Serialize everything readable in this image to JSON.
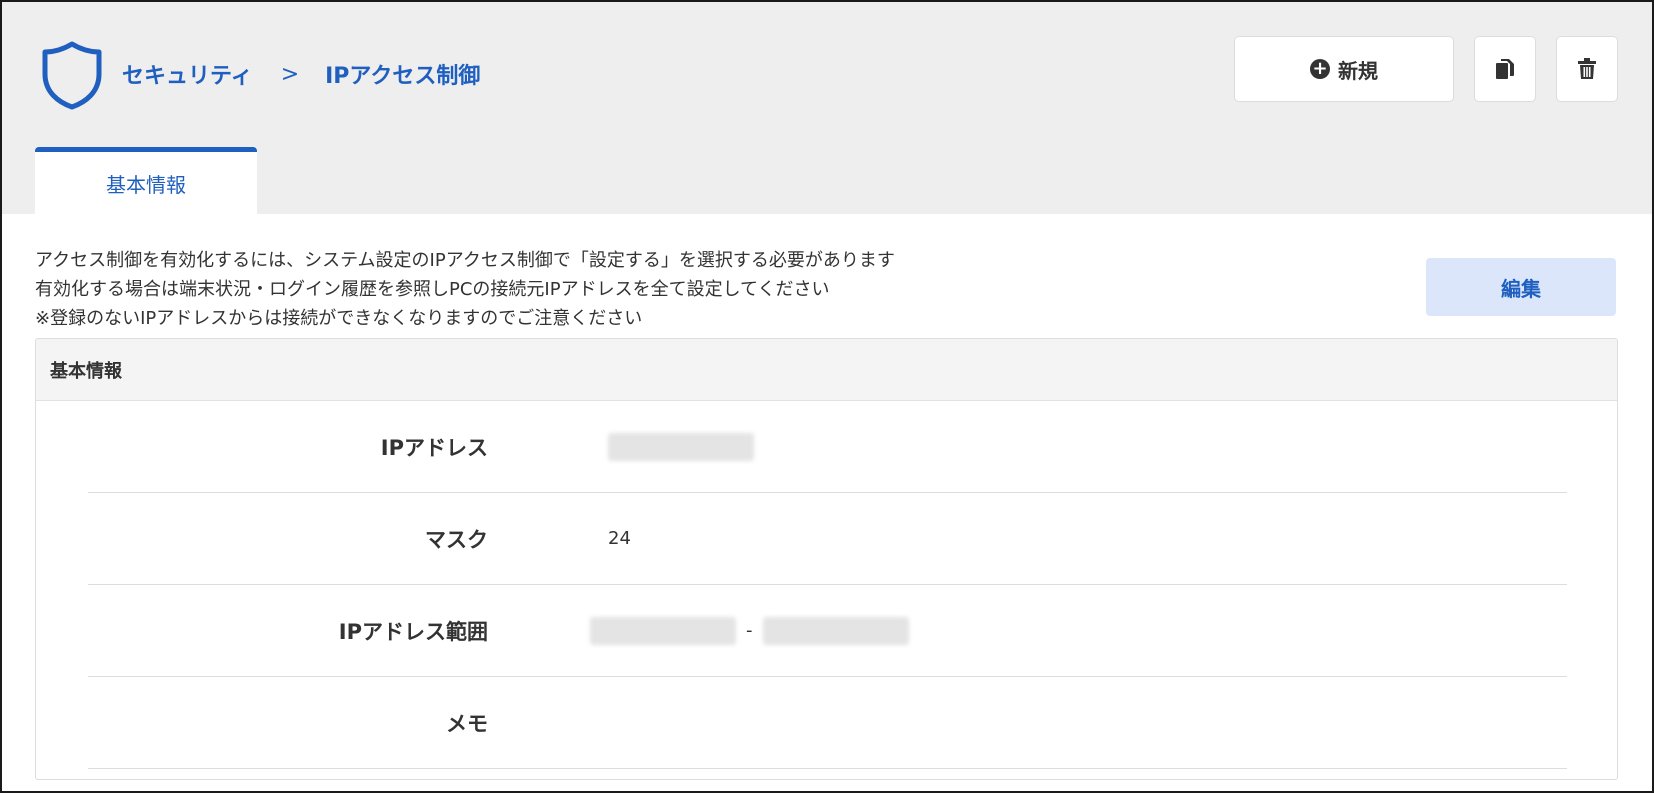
{
  "header": {
    "breadcrumb": [
      "セキュリティ",
      "IPアクセス制御"
    ],
    "breadcrumb_separator": ">",
    "icon": "shield-icon"
  },
  "toolbar": {
    "new_label": "新規",
    "new_icon": "plus-circle-icon",
    "copy_icon": "copy-icon",
    "delete_icon": "trash-icon"
  },
  "tabs": [
    {
      "label": "基本情報",
      "active": true
    }
  ],
  "notice": [
    "アクセス制御を有効化するには、システム設定のIPアクセス制御で「設定する」を選択する必要があります",
    "有効化する場合は端末状況・ログイン履歴を参照しPCの接続元IPアドレスを全て設定してください",
    "※登録のないIPアドレスからは接続ができなくなりますのでご注意ください"
  ],
  "edit_label": "編集",
  "card": {
    "title": "基本情報",
    "rows": [
      {
        "label": "IPアドレス",
        "value": ""
      },
      {
        "label": "マスク",
        "value": "24"
      },
      {
        "label": "IPアドレス範囲",
        "value": "",
        "range_separator": "-"
      },
      {
        "label": "メモ",
        "value": ""
      }
    ]
  },
  "colors": {
    "accent": "#1f5fbf",
    "band": "#eeeeee",
    "edit_bg": "#dbe6fa"
  }
}
